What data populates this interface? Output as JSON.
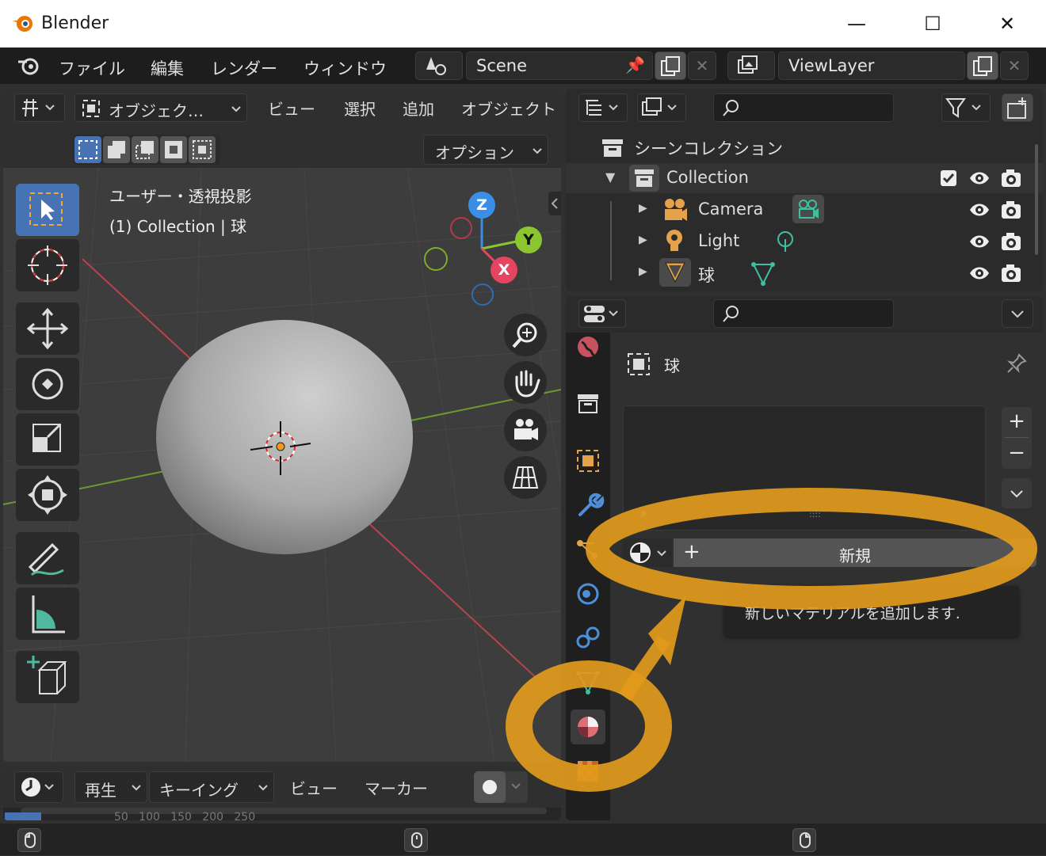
{
  "window": {
    "title": "Blender",
    "minimize": "—",
    "maximize": "☐",
    "close": "✕"
  },
  "menubar": {
    "items": [
      "ファイル",
      "編集",
      "レンダー",
      "ウィンドウ"
    ],
    "scene": "Scene",
    "viewlayer": "ViewLayer"
  },
  "viewport_header": {
    "mode": "オブジェク…",
    "menus": [
      "ビュー",
      "選択",
      "追加",
      "オブジェクト"
    ],
    "options": "オプション"
  },
  "viewport": {
    "view_name": "ユーザー・透視投影",
    "collection_info": "(1) Collection | 球",
    "gizmo": {
      "z": "Z",
      "y": "Y",
      "x": "X"
    }
  },
  "outliner": {
    "scene_collection": "シーンコレクション",
    "collection": "Collection",
    "objects": [
      "Camera",
      "Light",
      "球"
    ]
  },
  "properties": {
    "object_name": "球",
    "new_button": "新規",
    "tooltip": "新しいマテリアルを追加します.",
    "slot_handle": "::::",
    "add_slot": "+",
    "remove_slot": "−"
  },
  "timeline": {
    "items": [
      "再生",
      "キーイング",
      "ビュー",
      "マーカー"
    ],
    "ruler_hint": "50   100   150   200   250"
  },
  "colors": {
    "highlight": "#e29a1c",
    "active_tool": "#4772b3",
    "axis_x": "#e64561",
    "axis_y": "#8bc530",
    "axis_z": "#3b8ee6",
    "material_icon": "#e06c76"
  }
}
